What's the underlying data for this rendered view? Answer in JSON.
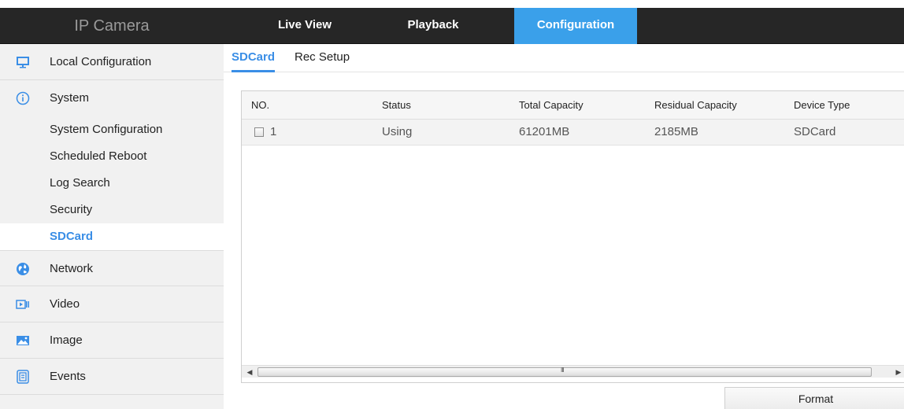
{
  "header": {
    "brand": "IP Camera",
    "tabs": [
      {
        "label": "Live View",
        "active": false
      },
      {
        "label": "Playback",
        "active": false
      },
      {
        "label": "Configuration",
        "active": true
      }
    ],
    "accent_color": "#3aa0ea"
  },
  "sidebar": {
    "items": [
      {
        "label": "Local Configuration",
        "icon": "monitor-icon"
      },
      {
        "label": "System",
        "icon": "info-icon"
      },
      {
        "label": "Network",
        "icon": "globe-icon"
      },
      {
        "label": "Video",
        "icon": "video-icon"
      },
      {
        "label": "Image",
        "icon": "image-icon"
      },
      {
        "label": "Events",
        "icon": "events-icon"
      }
    ],
    "system_subitems": [
      {
        "label": "System Configuration"
      },
      {
        "label": "Scheduled Reboot"
      },
      {
        "label": "Log Search"
      },
      {
        "label": "Security"
      },
      {
        "label": "SDCard",
        "active": true
      }
    ]
  },
  "content": {
    "subtabs": [
      {
        "label": "SDCard",
        "active": true
      },
      {
        "label": "Rec Setup",
        "active": false
      }
    ],
    "table": {
      "columns": [
        "NO.",
        "Status",
        "Total Capacity",
        "Residual Capacity",
        "Device Type"
      ],
      "rows": [
        {
          "no": "1",
          "status": "Using",
          "total": "61201MB",
          "residual": "2185MB",
          "device_type": "SDCard",
          "checked": false
        }
      ]
    },
    "scroll_grip": "III",
    "format_button": "Format"
  }
}
